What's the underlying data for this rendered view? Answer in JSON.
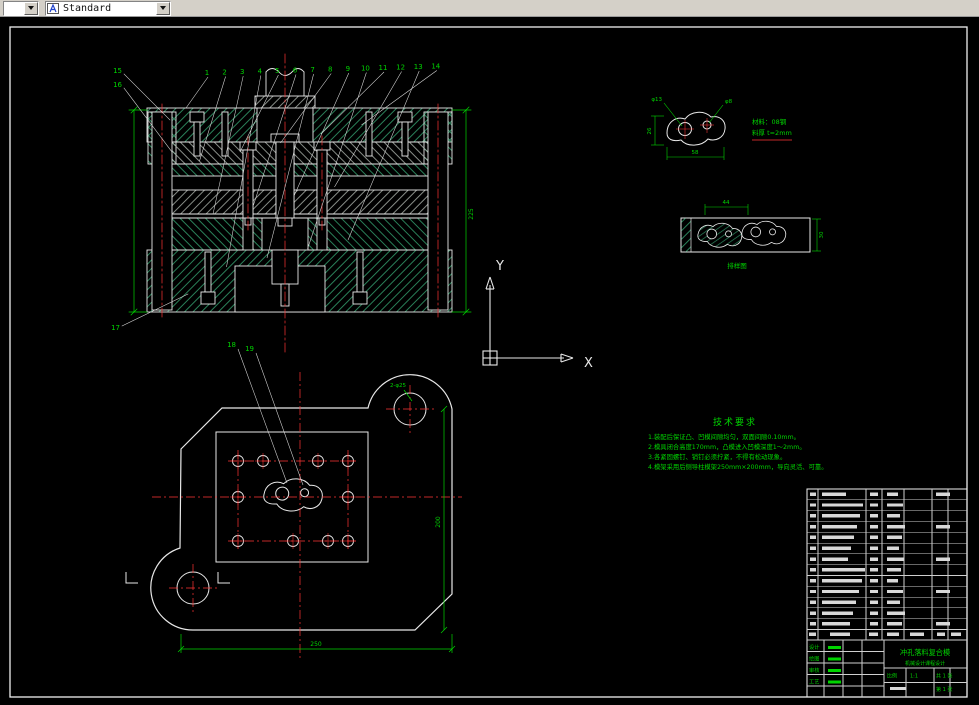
{
  "toolbar": {
    "standard_label": "Standard"
  },
  "ucs": {
    "x_label": "X",
    "y_label": "Y"
  },
  "callouts": {
    "top": [
      "1",
      "2",
      "3",
      "4",
      "5",
      "6",
      "7",
      "8",
      "9",
      "10",
      "11",
      "12",
      "13",
      "14"
    ],
    "left": [
      "15",
      "16",
      "17"
    ],
    "plan": [
      "18",
      "19"
    ]
  },
  "dims": {
    "section_height": "225",
    "plan_width": "250",
    "plan_height": "200",
    "part_width": "58",
    "part_height": "26",
    "part_hole_small": "φ8",
    "part_hole_big": "φ13",
    "strip_pitch": "44",
    "strip_width": "30",
    "guide_holes": "2-φ25"
  },
  "part_notes": {
    "line1": "材料：08钢",
    "line2": "料厚 t=2mm"
  },
  "strip_label": "排样图",
  "tech_requirements": {
    "title": "技术要求",
    "items": [
      "1.装配后保证凸、凹模间隙均匀，双面间隙0.10mm。",
      "2.模具闭合高度170mm，凸模进入凹模深度1～2mm。",
      "3.各紧固螺钉、销钉必须拧紧，不得有松动现象。",
      "4.模架采用后侧导柱模架250mm×200mm，导向灵活、可靠。"
    ]
  },
  "title_block": {
    "signature_labels": [
      "设计",
      "绘图",
      "审核",
      "工艺"
    ],
    "drawing_title": "冲孔落料复合模",
    "org": "机械设计课程设计",
    "scale_label": "比例",
    "scale": "1:1",
    "sheet_total": "共 1 张",
    "sheet_no": "第 1 张"
  }
}
